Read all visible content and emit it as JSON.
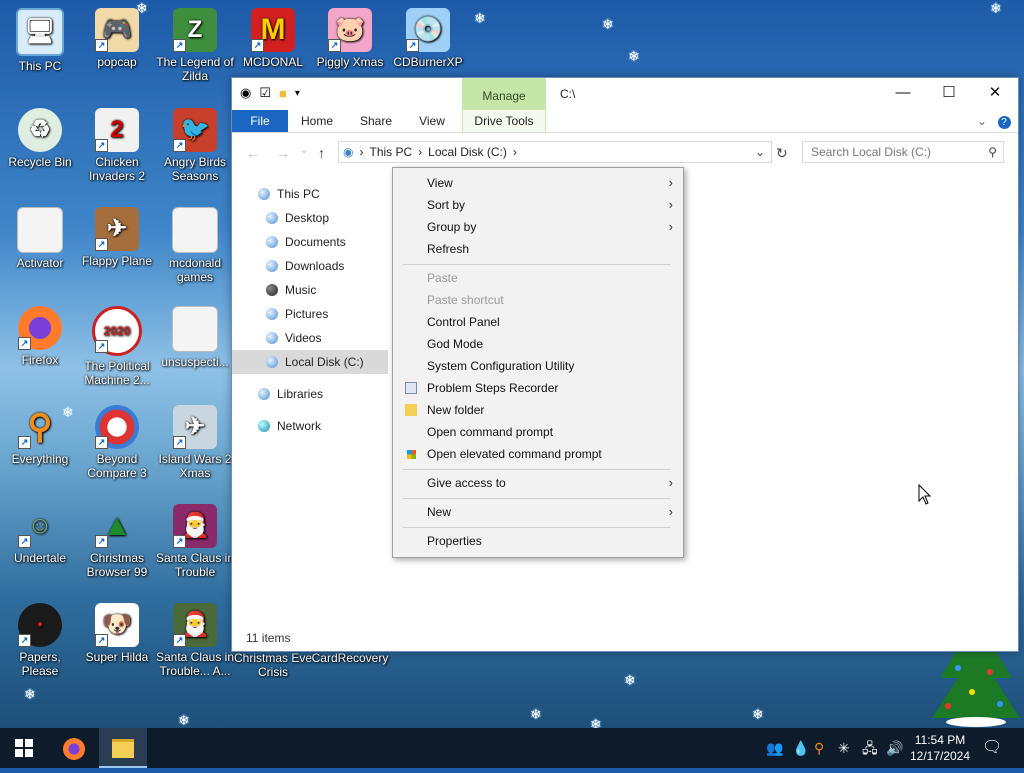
{
  "desktop": {
    "icons": [
      {
        "label": "This PC"
      },
      {
        "label": "popcap"
      },
      {
        "label": "The Legend of Zilda"
      },
      {
        "label": "MCDONAL"
      },
      {
        "label": "Piggly Xmas"
      },
      {
        "label": "CDBurnerXP"
      },
      {
        "label": "Recycle Bin"
      },
      {
        "label": "Chicken Invaders 2"
      },
      {
        "label": "Angry Birds Seasons"
      },
      {
        "label": "Activator"
      },
      {
        "label": "Flappy Plane"
      },
      {
        "label": "mcdonald games"
      },
      {
        "label": "Firefox"
      },
      {
        "label": "The Political Machine 2..."
      },
      {
        "label": "unsuspecti..."
      },
      {
        "label": "Everything"
      },
      {
        "label": "Beyond Compare 3"
      },
      {
        "label": "Island Wars 2 Xmas"
      },
      {
        "label": "Undertale"
      },
      {
        "label": "Christmas Browser 99"
      },
      {
        "label": "Santa Claus in Trouble"
      },
      {
        "label": "Papers, Please"
      },
      {
        "label": "Super Hilda"
      },
      {
        "label": "Santa Claus in Trouble... A..."
      },
      {
        "label": "Christmas Eve Crisis"
      },
      {
        "label": "CardRecovery"
      }
    ]
  },
  "explorer": {
    "title": "C:\\",
    "manage_tab": "Manage",
    "ribbon_tabs": [
      "File",
      "Home",
      "Share",
      "View",
      "Drive Tools"
    ],
    "address": {
      "root": "This PC",
      "current": "Local Disk (C:)"
    },
    "search_placeholder": "Search Local Disk (C:)",
    "nav": [
      "This PC",
      "Desktop",
      "Documents",
      "Downloads",
      "Music",
      "Pictures",
      "Videos",
      "Local Disk (C:)",
      "Libraries",
      "Network"
    ],
    "status": "11 items"
  },
  "context_menu": {
    "items": [
      {
        "label": "View",
        "submenu": true
      },
      {
        "label": "Sort by",
        "submenu": true
      },
      {
        "label": "Group by",
        "submenu": true
      },
      {
        "label": "Refresh"
      },
      {
        "label": "Paste",
        "disabled": true
      },
      {
        "label": "Paste shortcut",
        "disabled": true
      },
      {
        "label": "Control Panel"
      },
      {
        "label": "God Mode"
      },
      {
        "label": "System Configuration Utility"
      },
      {
        "label": "Problem Steps Recorder"
      },
      {
        "label": "New folder"
      },
      {
        "label": "Open command prompt"
      },
      {
        "label": "Open elevated command prompt"
      },
      {
        "label": "Give access to",
        "submenu": true
      },
      {
        "label": "New",
        "submenu": true
      },
      {
        "label": "Properties"
      }
    ]
  },
  "taskbar": {
    "time": "11:54 PM",
    "date": "12/17/2024"
  }
}
